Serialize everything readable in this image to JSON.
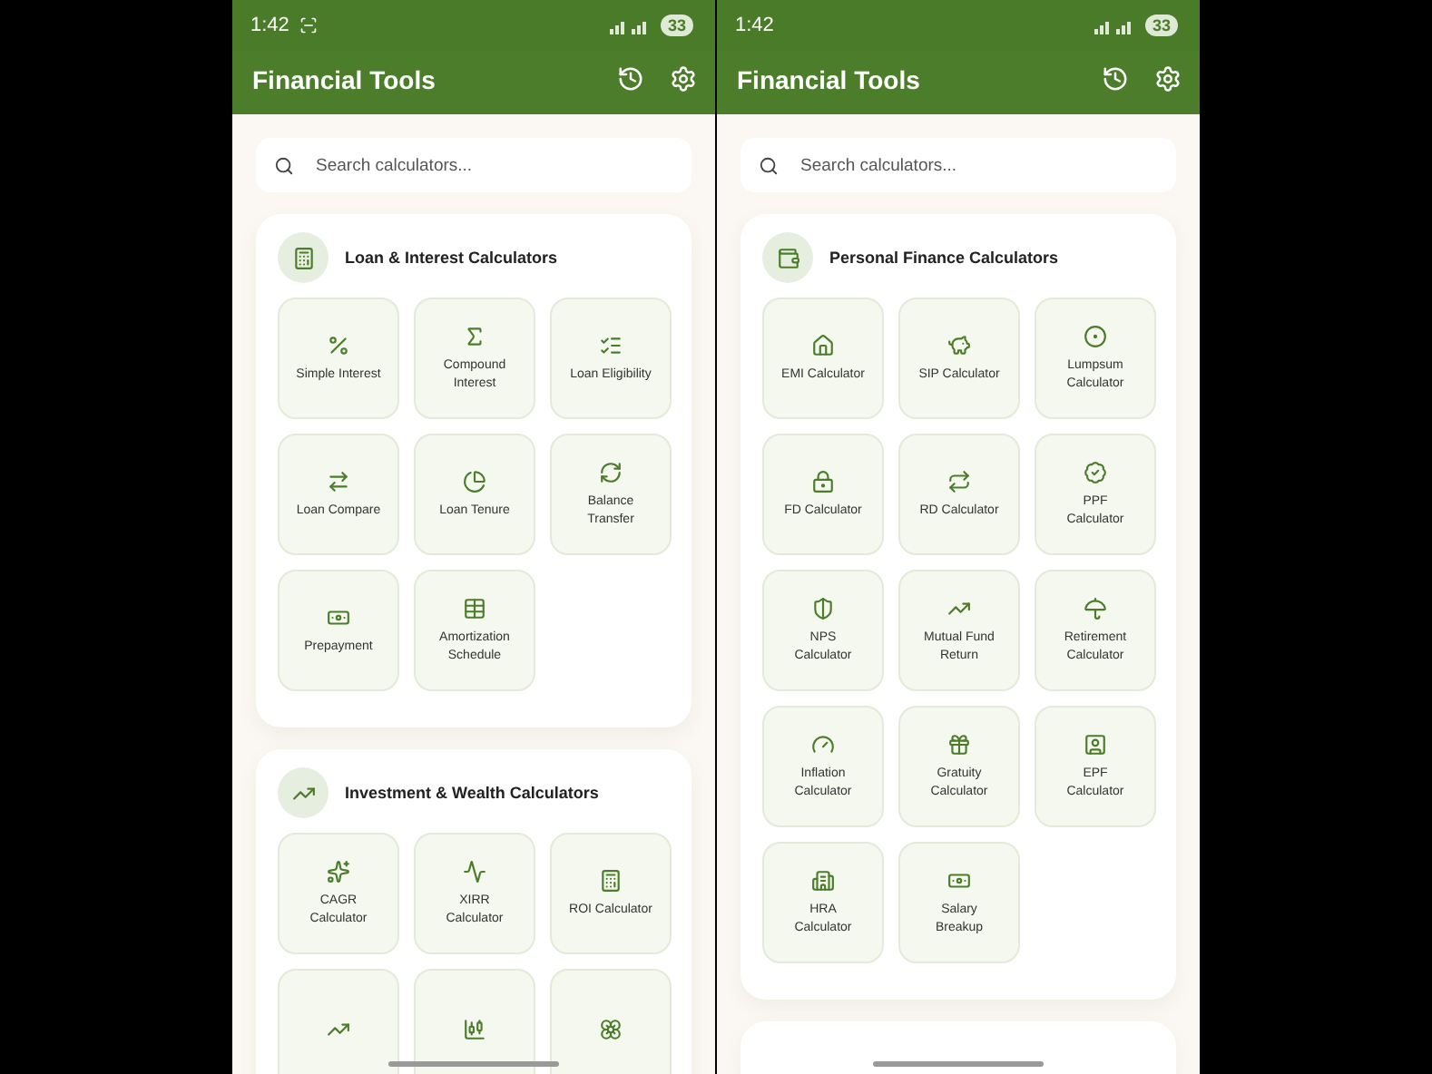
{
  "phones": [
    {
      "status": {
        "time": "1:42",
        "capture_indicator": true,
        "battery": "33"
      },
      "title": "Financial Tools",
      "search": {
        "placeholder": "Search calculators..."
      },
      "sections": [
        {
          "title": "Loan & Interest Calculators",
          "tiles": [
            {
              "label": "Simple Interest"
            },
            {
              "label": "Compound Interest"
            },
            {
              "label": "Loan Eligibility"
            },
            {
              "label": "Loan Compare"
            },
            {
              "label": "Loan Tenure"
            },
            {
              "label": "Balance Transfer"
            },
            {
              "label": "Prepayment"
            },
            {
              "label": "Amortization Schedule"
            }
          ]
        },
        {
          "title": "Investment & Wealth Calculators",
          "tiles": [
            {
              "label": "CAGR Calculator"
            },
            {
              "label": "XIRR Calculator"
            },
            {
              "label": "ROI Calculator"
            },
            {
              "kind": "icon_only"
            },
            {
              "kind": "icon_only"
            },
            {
              "kind": "icon_only"
            }
          ]
        }
      ]
    },
    {
      "status": {
        "time": "1:42",
        "capture_indicator": false,
        "battery": "33"
      },
      "title": "Financial Tools",
      "search": {
        "placeholder": "Search calculators..."
      },
      "sections": [
        {
          "title": "Personal Finance Calculators",
          "tiles": [
            {
              "label": "EMI Calculator"
            },
            {
              "label": "SIP Calculator"
            },
            {
              "label": "Lumpsum Calculator"
            },
            {
              "label": "FD Calculator"
            },
            {
              "label": "RD Calculator"
            },
            {
              "label": "PPF Calculator"
            },
            {
              "label": "NPS Calculator"
            },
            {
              "label": "Mutual Fund Return"
            },
            {
              "label": "Retirement Calculator"
            },
            {
              "label": "Inflation Calculator"
            },
            {
              "label": "Gratuity Calculator"
            },
            {
              "label": "EPF Calculator"
            },
            {
              "label": "HRA Calculator"
            },
            {
              "label": "Salary Breakup"
            }
          ]
        }
      ]
    }
  ]
}
